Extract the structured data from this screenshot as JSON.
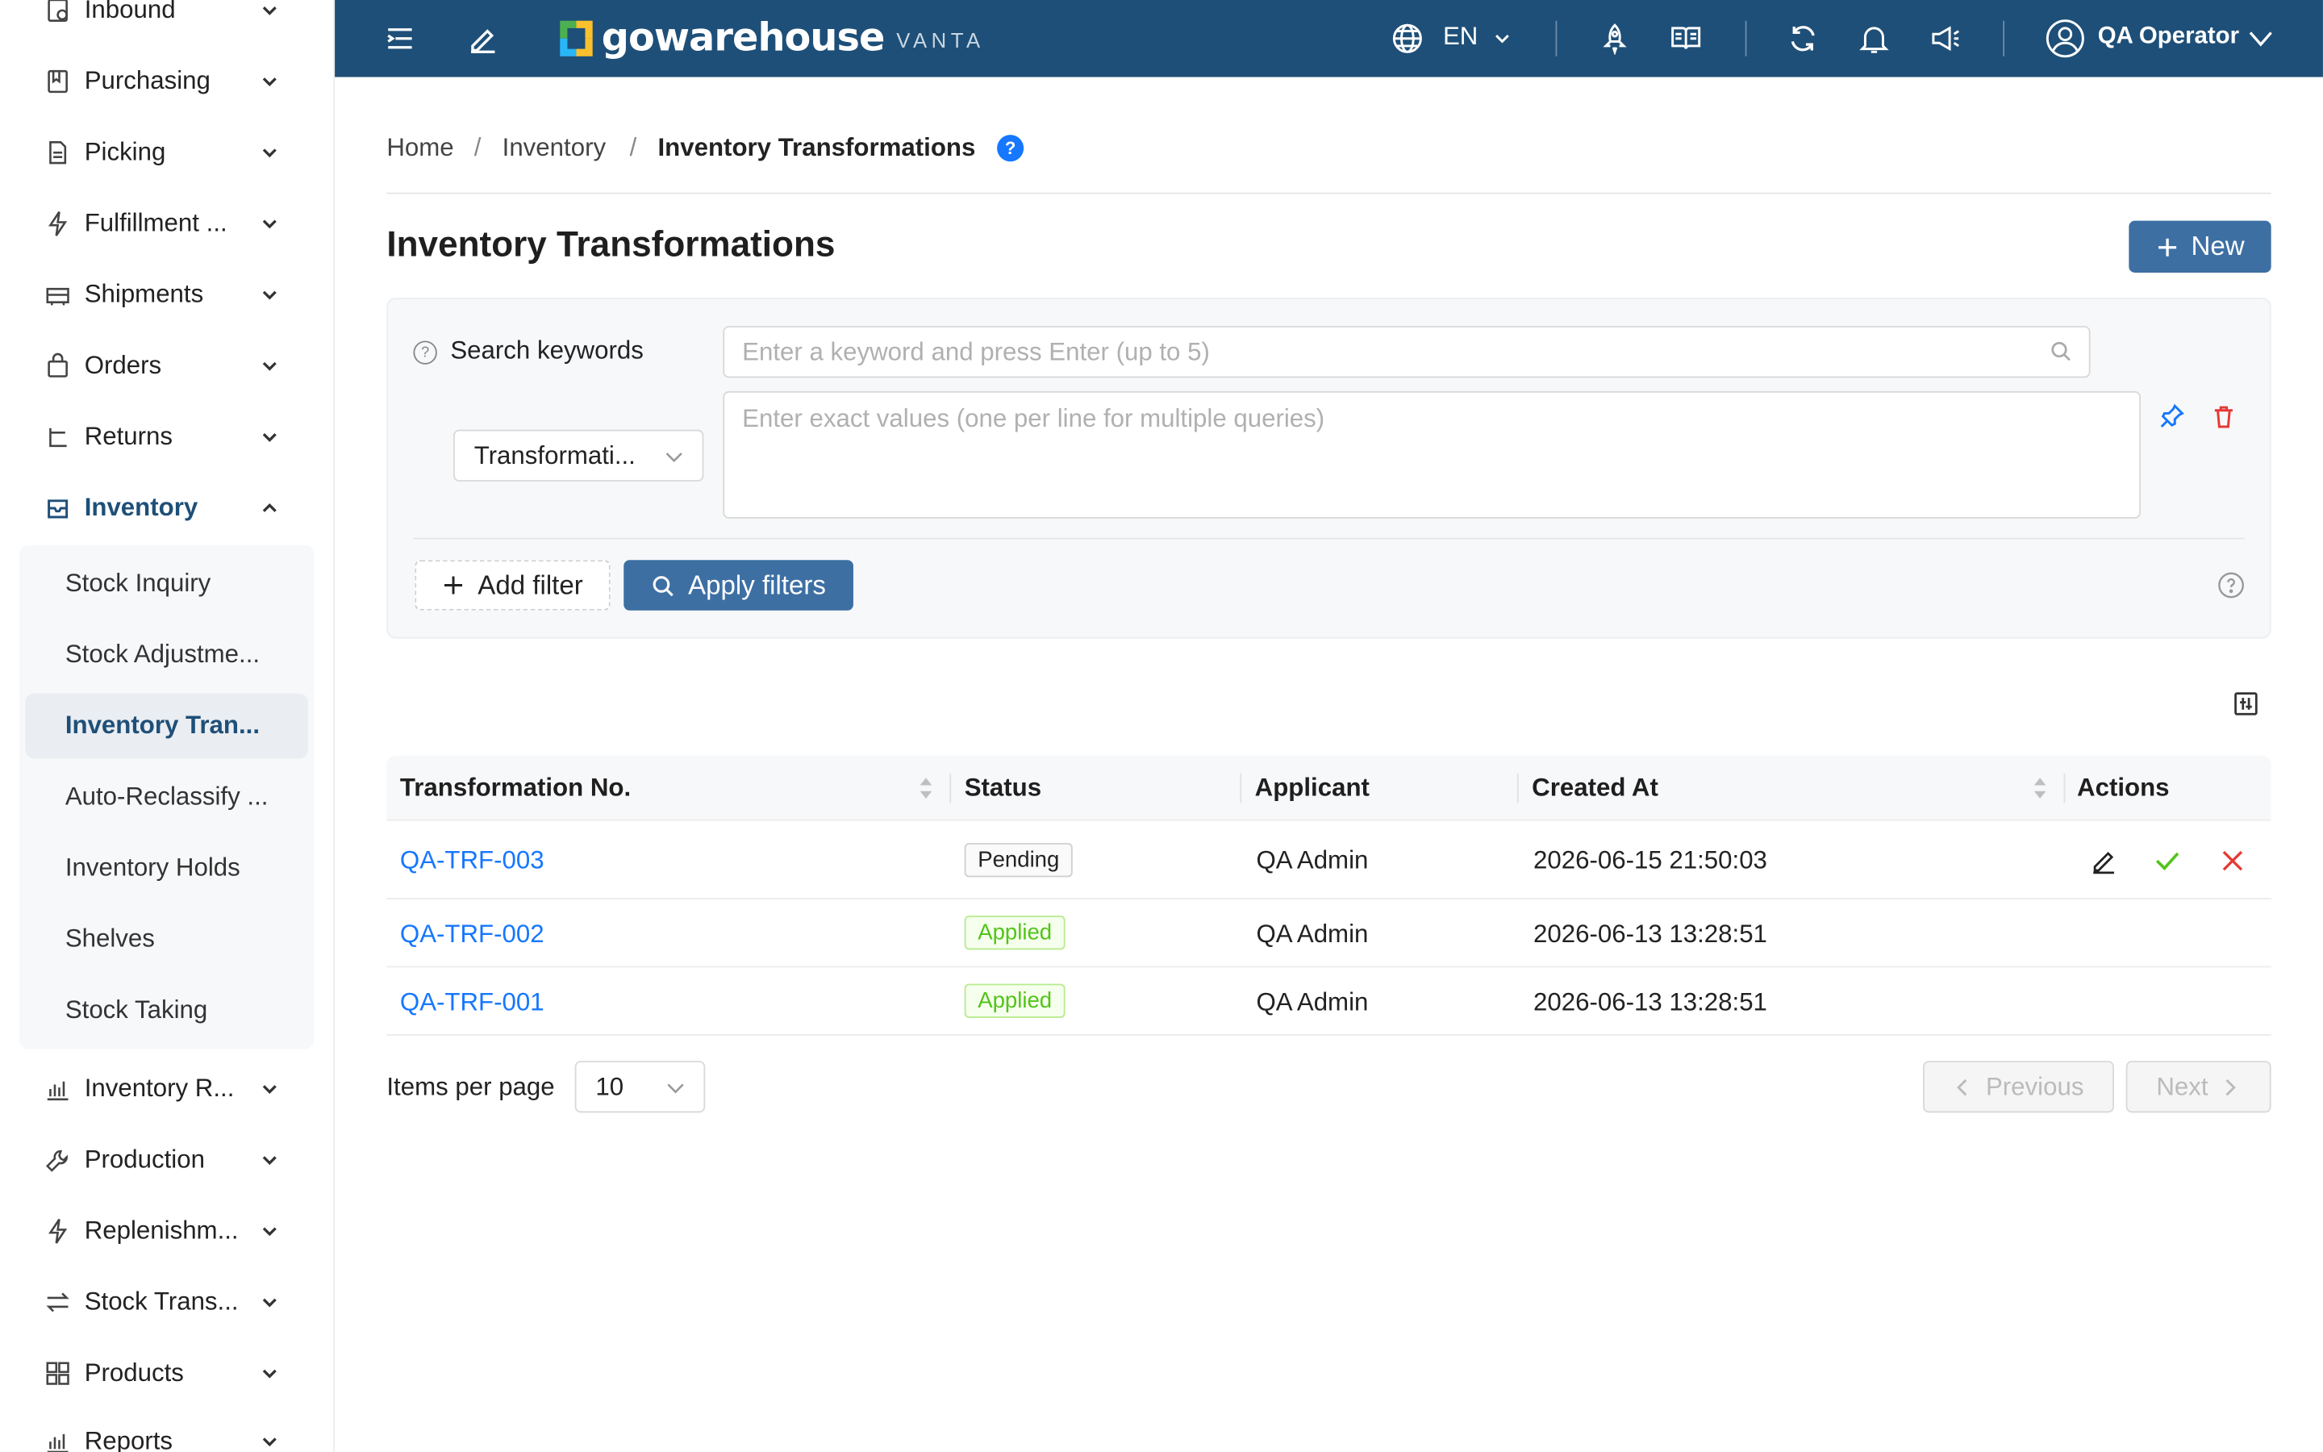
{
  "sidebar": {
    "items": [
      {
        "label": "Inbound",
        "icon": "inbound-icon",
        "expanded": false
      },
      {
        "label": "Purchasing",
        "icon": "purchasing-icon",
        "expanded": false
      },
      {
        "label": "Picking",
        "icon": "picking-icon",
        "expanded": false
      },
      {
        "label": "Fulfillment ...",
        "icon": "lightning-icon",
        "expanded": false
      },
      {
        "label": "Shipments",
        "icon": "truck-icon",
        "expanded": false
      },
      {
        "label": "Orders",
        "icon": "bag-icon",
        "expanded": false
      },
      {
        "label": "Returns",
        "icon": "return-icon",
        "expanded": false
      },
      {
        "label": "Inventory",
        "icon": "inbox-icon",
        "expanded": true
      },
      {
        "label": "Inventory R...",
        "icon": "bar-chart-icon",
        "expanded": false
      },
      {
        "label": "Production",
        "icon": "wrench-icon",
        "expanded": false
      },
      {
        "label": "Replenishm...",
        "icon": "lightning-icon",
        "expanded": false
      },
      {
        "label": "Stock Trans...",
        "icon": "swap-icon",
        "expanded": false
      },
      {
        "label": "Products",
        "icon": "grid-icon",
        "expanded": false
      },
      {
        "label": "Reports",
        "icon": "bar-chart-icon",
        "expanded": false
      }
    ],
    "inventory_submenu": [
      {
        "label": "Stock Inquiry"
      },
      {
        "label": "Stock Adjustme..."
      },
      {
        "label": "Inventory Tran...",
        "selected": true
      },
      {
        "label": "Auto-Reclassify ..."
      },
      {
        "label": "Inventory Holds"
      },
      {
        "label": "Shelves"
      },
      {
        "label": "Stock Taking"
      }
    ]
  },
  "topbar": {
    "logo_text": "gowarehouse",
    "logo_sub": "VANTA",
    "language": "EN",
    "user_name": "QA Operator",
    "bg_color": "#1e4f78"
  },
  "breadcrumb": {
    "home": "Home",
    "section": "Inventory",
    "current": "Inventory Transformations"
  },
  "page": {
    "title": "Inventory Transformations",
    "new_button": "New"
  },
  "filters": {
    "search_label": "Search keywords",
    "keyword_placeholder": "Enter a keyword and press Enter (up to 5)",
    "field_select": "Transformati...",
    "exact_placeholder": "Enter exact values (one per line for multiple queries)",
    "add_filter": "Add filter",
    "apply_filters": "Apply filters"
  },
  "table": {
    "columns": [
      "Transformation No.",
      "Status",
      "Applicant",
      "Created At",
      "Actions"
    ],
    "rows": [
      {
        "no": "QA-TRF-003",
        "status": "Pending",
        "applicant": "QA Admin",
        "created_at": "2026-06-15 21:50:03",
        "has_actions": true
      },
      {
        "no": "QA-TRF-002",
        "status": "Applied",
        "applicant": "QA Admin",
        "created_at": "2026-06-13 13:28:51",
        "has_actions": false
      },
      {
        "no": "QA-TRF-001",
        "status": "Applied",
        "applicant": "QA Admin",
        "created_at": "2026-06-13 13:28:51",
        "has_actions": false
      }
    ]
  },
  "pagination": {
    "items_per_page_label": "Items per page",
    "items_per_page": "10",
    "previous": "Previous",
    "next": "Next"
  }
}
